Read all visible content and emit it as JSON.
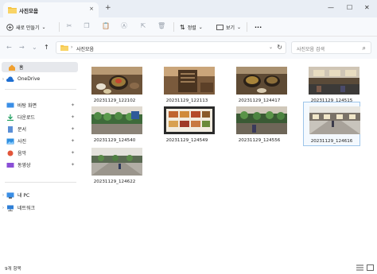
{
  "window": {
    "tab_title": "사진모음",
    "tab_close": "×",
    "new_tab": "+",
    "controls": {
      "minimize": "—",
      "maximize": "☐",
      "close": "✕"
    }
  },
  "toolbar": {
    "new_label": "새로 만들기",
    "new_chevron": "⌄",
    "sort_label": "정렬",
    "sort_chevron": "⌄",
    "view_label": "보기",
    "view_chevron": "⌄",
    "more_label": "···"
  },
  "address": {
    "breadcrumb_sep": "›",
    "current_folder": "사진모음",
    "chevron": "⌄",
    "refresh": "↻",
    "search_placeholder": "사진모음 검색",
    "nav_back": "←",
    "nav_forward": "→",
    "nav_recent": "⌄",
    "nav_up": "↑"
  },
  "sidebar": {
    "items": [
      {
        "label": "홈",
        "icon": "home-icon",
        "selected": true,
        "chevron": ""
      },
      {
        "label": "OneDrive",
        "icon": "cloud-icon",
        "selected": false,
        "chevron": "›"
      },
      {
        "label": "바탕 화면",
        "icon": "desktop-icon",
        "pinned": true
      },
      {
        "label": "다운로드",
        "icon": "download-icon",
        "pinned": true
      },
      {
        "label": "문서",
        "icon": "document-icon",
        "pinned": true
      },
      {
        "label": "사진",
        "icon": "pictures-icon",
        "pinned": true
      },
      {
        "label": "음악",
        "icon": "music-icon",
        "pinned": true
      },
      {
        "label": "동영상",
        "icon": "video-icon",
        "pinned": true
      },
      {
        "label": "내 PC",
        "icon": "pc-icon",
        "chevron": "›"
      },
      {
        "label": "네트워크",
        "icon": "network-icon",
        "chevron": "›"
      }
    ],
    "pin_glyph": "✦"
  },
  "files": [
    {
      "name": "20231129_122102",
      "thumb": "bibimbap"
    },
    {
      "name": "20231129_122113",
      "thumb": "menu-board"
    },
    {
      "name": "20231129_124417",
      "thumb": "bibimbap"
    },
    {
      "name": "20231129_124515",
      "thumb": "foodcourt"
    },
    {
      "name": "20231129_124540",
      "thumb": "plants"
    },
    {
      "name": "20231129_124549",
      "thumb": "menu-screen"
    },
    {
      "name": "20231129_124556",
      "thumb": "plants"
    },
    {
      "name": "20231129_124616",
      "thumb": "hall",
      "selected": true
    },
    {
      "name": "20231129_124622",
      "thumb": "hall2"
    }
  ],
  "status": {
    "item_count": "9개 항목"
  },
  "colors": {
    "accent": "#0a64c8",
    "folder": "#f5c342",
    "selection": "#9ec5ea"
  }
}
